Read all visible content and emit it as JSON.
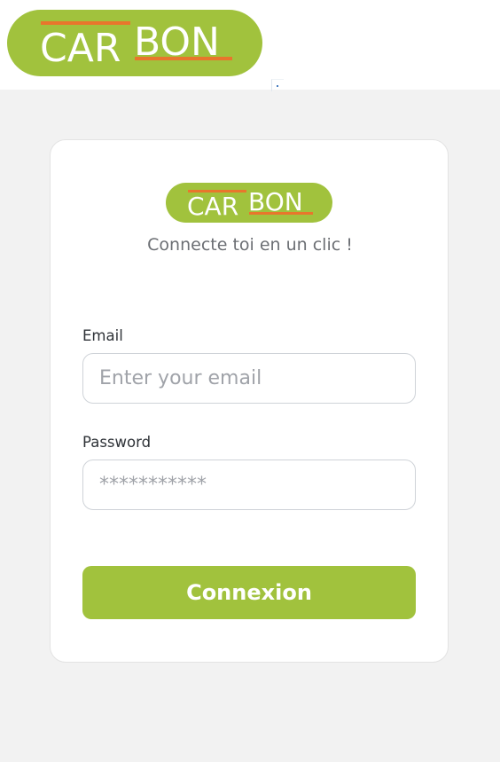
{
  "brand": {
    "name": "CARBON",
    "part1": "CAR",
    "part2": "BON",
    "accent": "#a1c23d",
    "stripe": "#e8762c"
  },
  "login": {
    "subtitle": "Connecte toi en un clic !",
    "email_label": "Email",
    "email_placeholder": "Enter your email",
    "password_label": "Password",
    "password_placeholder": "***********",
    "submit_label": "Connexion"
  }
}
